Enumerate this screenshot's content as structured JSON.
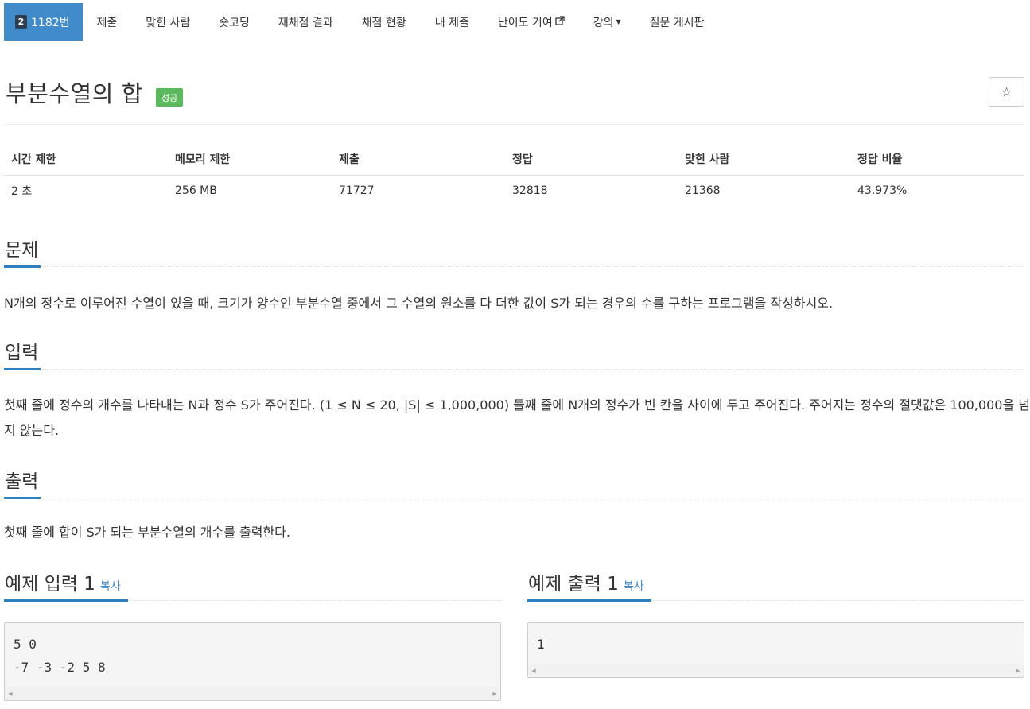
{
  "nav": {
    "level_badge": "2",
    "problem_label": "1182번",
    "submit": "제출",
    "solved_users": "맞힌 사람",
    "short_coding": "숏코딩",
    "rejudge": "재채점 결과",
    "judge_status": "채점 현황",
    "my_submissions": "내 제출",
    "difficulty": "난이도 기여",
    "lecture": "강의",
    "board": "질문 게시판"
  },
  "problem": {
    "title": "부분수열의 합",
    "status": "성공",
    "star_icon": "☆"
  },
  "info": {
    "headers": [
      "시간 제한",
      "메모리 제한",
      "제출",
      "정답",
      "맞힌 사람",
      "정답 비율"
    ],
    "values": [
      "2 초",
      "256 MB",
      "71727",
      "32818",
      "21368",
      "43.973%"
    ]
  },
  "sections": {
    "description_title": "문제",
    "description": "N개의 정수로 이루어진 수열이 있을 때, 크기가 양수인 부분수열 중에서 그 수열의 원소를 다 더한 값이 S가 되는 경우의 수를 구하는 프로그램을 작성하시오.",
    "input_title": "입력",
    "input": "첫째 줄에 정수의 개수를 나타내는 N과 정수 S가 주어진다. (1 ≤ N ≤ 20, |S| ≤ 1,000,000) 둘째 줄에 N개의 정수가 빈 칸을 사이에 두고 주어진다. 주어지는 정수의 절댓값은 100,000을 넘지 않는다.",
    "output_title": "출력",
    "output": "첫째 줄에 합이 S가 되는 부분수열의 개수를 출력한다."
  },
  "samples": {
    "input_title": "예제 입력 1",
    "output_title": "예제 출력 1",
    "copy_label": "복사",
    "input_text": "5 0\n-7 -3 -2 5 8",
    "output_text": "1"
  },
  "colors": {
    "accent": "#428bca",
    "success": "#5cb85c",
    "underline": "#2c80c2"
  }
}
